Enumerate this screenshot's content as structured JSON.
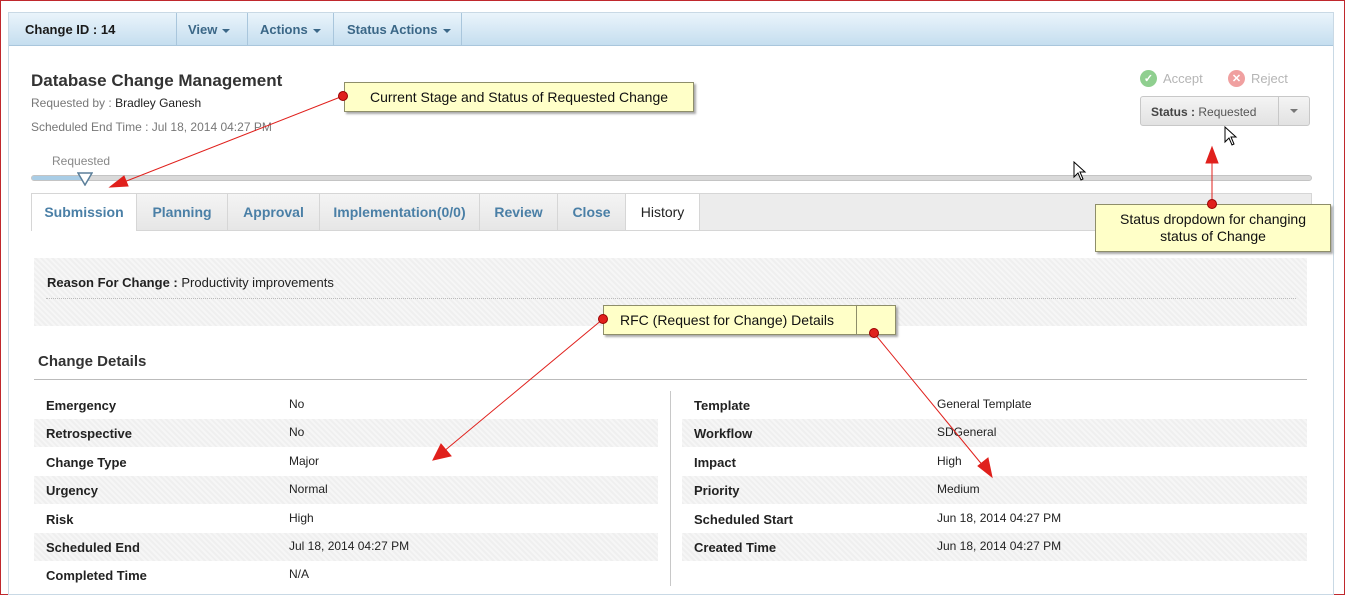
{
  "toolbar": {
    "change_id": "Change ID : 14",
    "menus": [
      "View",
      "Actions",
      "Status Actions"
    ]
  },
  "header": {
    "title": "Database Change Management",
    "requested_by_label": "Requested by :",
    "requested_by_value": "Bradley Ganesh",
    "scheduled_end": "Scheduled End Time : Jul 18, 2014 04:27 PM"
  },
  "actions": {
    "accept": "Accept",
    "reject": "Reject",
    "status_label": "Status :",
    "status_value": "Requested"
  },
  "stage": {
    "current": "Requested"
  },
  "tabs": [
    "Submission",
    "Planning",
    "Approval",
    "Implementation(0/0)",
    "Review",
    "Close",
    "History"
  ],
  "reason": {
    "label": "Reason For Change :",
    "value": "Productivity improvements"
  },
  "details": {
    "title": "Change Details",
    "left": [
      {
        "k": "Emergency",
        "v": "No"
      },
      {
        "k": "Retrospective",
        "v": "No"
      },
      {
        "k": "Change Type",
        "v": "Major"
      },
      {
        "k": "Urgency",
        "v": "Normal"
      },
      {
        "k": "Risk",
        "v": "High"
      },
      {
        "k": "Scheduled End",
        "v": "Jul 18, 2014 04:27 PM"
      },
      {
        "k": "Completed Time",
        "v": "N/A"
      }
    ],
    "right": [
      {
        "k": "Template",
        "v": "General Template"
      },
      {
        "k": "Workflow",
        "v": "SDGeneral"
      },
      {
        "k": "Impact",
        "v": "High"
      },
      {
        "k": "Priority",
        "v": "Medium"
      },
      {
        "k": "Scheduled Start",
        "v": "Jun 18, 2014 04:27 PM"
      },
      {
        "k": "Created Time",
        "v": "Jun 18, 2014 04:27 PM"
      }
    ]
  },
  "callouts": {
    "stage": "Current Stage and Status of Requested Change",
    "status_line1": "Status dropdown for changing",
    "status_line2": "status of Change",
    "rfc": "RFC (Request for Change)  Details"
  },
  "colors": {
    "link": "#4a7fa6",
    "accept": "#8fcf8f",
    "reject": "#f0a0a0",
    "callout_bg": "#ffffc8",
    "arrow": "#e0201c"
  }
}
